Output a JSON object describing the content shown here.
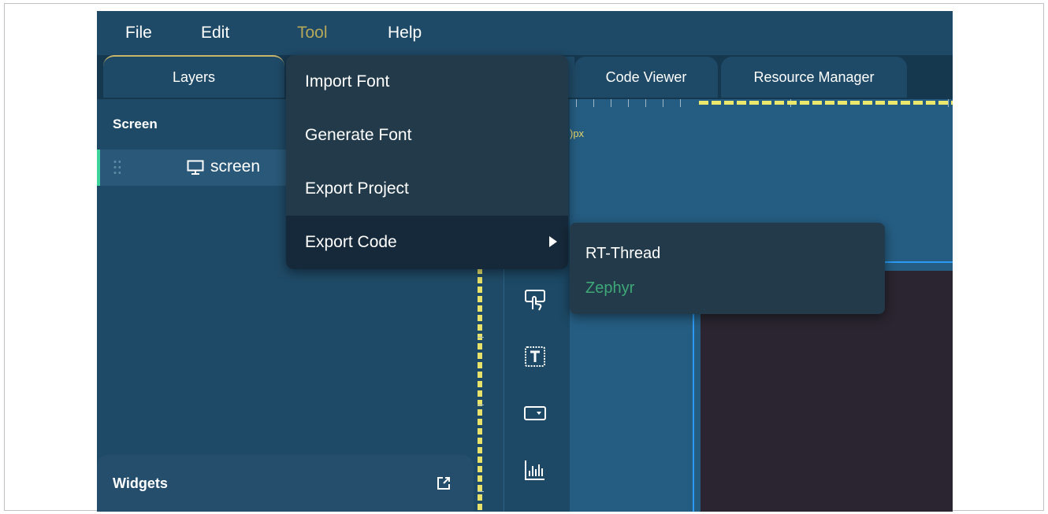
{
  "menubar": {
    "items": [
      {
        "label": "File"
      },
      {
        "label": "Edit"
      },
      {
        "label": "Tool",
        "active": true
      },
      {
        "label": "Help"
      }
    ]
  },
  "tabs": {
    "layers": "Layers",
    "code_viewer": "Code Viewer",
    "resource_manager": "Resource Manager"
  },
  "layers_panel": {
    "title": "Screen",
    "tree_item": {
      "label": "screen",
      "icon": "monitor-icon"
    }
  },
  "widgets_panel": {
    "title": "Widgets",
    "icon": "popout-icon"
  },
  "canvas": {
    "size_label_fragment": ")px",
    "accent_ruler_color": "#e8e26a",
    "selection_color": "#2b9af3"
  },
  "tool_menu": {
    "items": [
      {
        "label": "Import Font"
      },
      {
        "label": "Generate Font"
      },
      {
        "label": "Export Project"
      },
      {
        "label": "Export Code",
        "has_submenu": true,
        "hovered": true
      }
    ]
  },
  "export_code_submenu": {
    "items": [
      {
        "label": "RT-Thread"
      },
      {
        "label": "Zephyr",
        "color": "#3fa877"
      }
    ]
  },
  "toolbox": {
    "icons": [
      "touch-icon",
      "text-icon",
      "dropdown-widget-icon",
      "chart-icon"
    ]
  },
  "colors": {
    "background": "#1f4a67",
    "menu_active": "#b7a85a",
    "menu_bg": "#223a4a",
    "selected_row_accent": "#3dd39a"
  }
}
